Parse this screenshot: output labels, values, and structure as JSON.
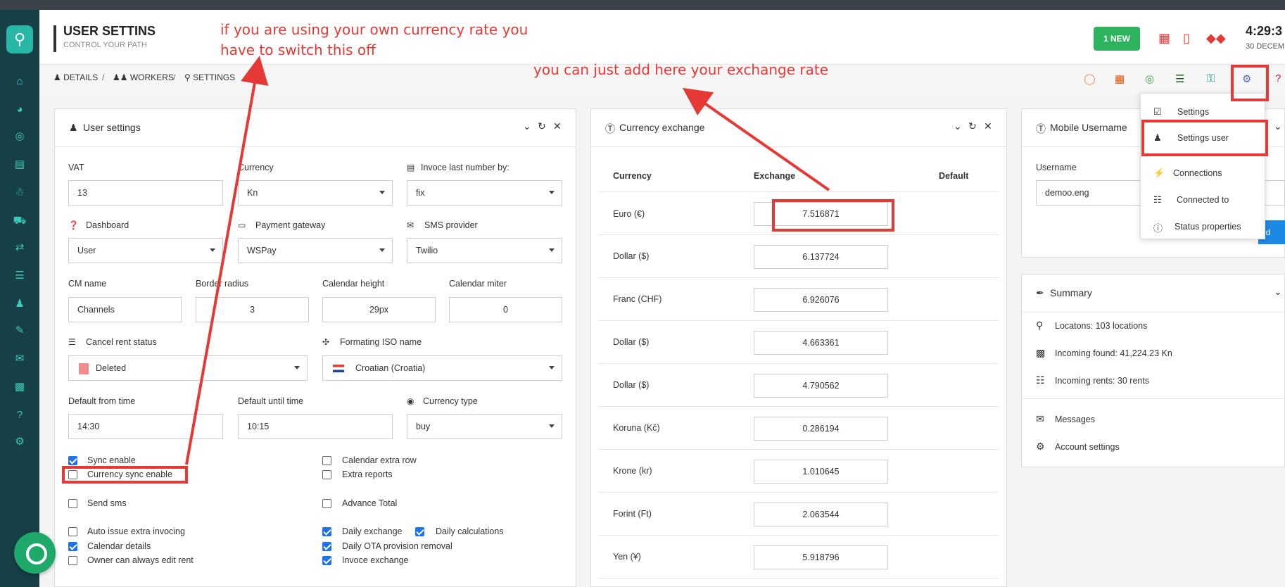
{
  "header": {
    "title": "USER SETTINS",
    "subtitle": "CONTROL YOUR PATH",
    "new_badge": "1 NEW",
    "time": "4:29:3",
    "date": "30 DECEM"
  },
  "breadcrumb": [
    "DETAILS",
    "WORKERS",
    "SETTINGS"
  ],
  "user_settings": {
    "title": "User settings",
    "vat_label": "VAT",
    "vat_value": "13",
    "currency_label": "Currency",
    "currency_value": "Kn",
    "invoice_label": "Invoce last number by:",
    "invoice_value": "fix",
    "dashboard_label": "Dashboard",
    "dashboard_value": "User",
    "payment_label": "Payment gateway",
    "payment_value": "WSPay",
    "sms_label": "SMS provider",
    "sms_value": "Twilio",
    "cm_label": "CM name",
    "cm_value": "Channels",
    "border_label": "Border radius",
    "border_value": "3",
    "cal_height_label": "Calendar height",
    "cal_height_value": "29px",
    "cal_miter_label": "Calendar miter",
    "cal_miter_value": "0",
    "cancel_label": "Cancel rent status",
    "cancel_value": "Deleted",
    "iso_label": "Formating ISO name",
    "iso_value": "Croatian (Croatia)",
    "from_label": "Default from time",
    "from_value": "14:30",
    "until_label": "Default until time",
    "until_value": "10:15",
    "ctype_label": "Currency type",
    "ctype_value": "buy",
    "checks": {
      "sync": "Sync enable",
      "currency_sync": "Currency sync enable",
      "send_sms": "Send sms",
      "auto_issue": "Auto issue extra invocing",
      "cal_details": "Calendar details",
      "owner_edit": "Owner can always edit rent",
      "cal_extra": "Calendar extra row",
      "extra_reports": "Extra reports",
      "adv_total": "Advance Total",
      "daily_exchange": "Daily exchange",
      "daily_calc": "Daily calculations",
      "daily_ota": "Daily OTA provision removal",
      "invoce_exchange": "Invoce exchange"
    }
  },
  "currency_exchange": {
    "title": "Currency exchange",
    "col_currency": "Currency",
    "col_exchange": "Exchange",
    "col_default": "Default",
    "rows": [
      {
        "name": "Euro (€)",
        "rate": "7.516871"
      },
      {
        "name": "Dollar ($)",
        "rate": "6.137724"
      },
      {
        "name": "Franc (CHF)",
        "rate": "6.926076"
      },
      {
        "name": "Dollar ($)",
        "rate": "4.663361"
      },
      {
        "name": "Dollar ($)",
        "rate": "4.790562"
      },
      {
        "name": "Koruna (Kč)",
        "rate": "0.286194"
      },
      {
        "name": "Krone (kr)",
        "rate": "1.010645"
      },
      {
        "name": "Forint (Ft)",
        "rate": "2.063544"
      },
      {
        "name": "Yen (¥)",
        "rate": "5.918796"
      }
    ]
  },
  "mobile": {
    "title": "Mobile Username",
    "username_label": "Username",
    "username_value": "demoo.eng",
    "add_label": "dd"
  },
  "menu": [
    "Settings",
    "Settings user",
    "Connections",
    "Connected to",
    "Status properties"
  ],
  "summary": {
    "title": "Summary",
    "locations": "Locatons: 103 locations",
    "incoming": "Incoming found:  41,224.23  Kn",
    "rents": "Incoming rents: 30 rents",
    "messages": "Messages",
    "account": "Account settings"
  },
  "annotations": {
    "switch_off_line1": "if you are using your own currency rate you",
    "switch_off_line2": "have to switch this off",
    "exchange_rate": "you can just add here your exchange rate"
  },
  "colors": {
    "accent": "#e53935",
    "sidebar": "#163f46",
    "new_badge": "#2db35d"
  }
}
